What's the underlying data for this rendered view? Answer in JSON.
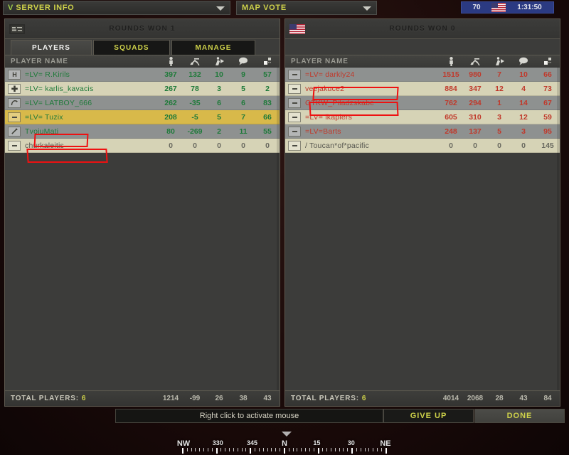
{
  "topbar": {
    "server_info_label": "SERVER INFO",
    "map_vote_label": "MAP VOTE"
  },
  "hud": {
    "tickets": "70",
    "time": "1:31:50",
    "flag_icon": "us-flag-icon"
  },
  "teams": [
    {
      "side": "left",
      "flag_icon": "mec-flag-icon",
      "rounds_won_label": "ROUNDS WON 1",
      "tabs": [
        {
          "label": "PLAYERS",
          "active": true
        },
        {
          "label": "SQUADS",
          "active": false
        },
        {
          "label": "MANAGE",
          "active": false
        }
      ],
      "columns": {
        "name_header": "PLAYER NAME",
        "icons": [
          "player-icon",
          "kills-icon",
          "deaths-icon",
          "chat-icon",
          "squad-icon"
        ]
      },
      "players": [
        {
          "class_icon": "support-icon",
          "name": "=LV= R.Kirils",
          "stats": [
            "397",
            "132",
            "10",
            "9",
            "57"
          ],
          "row": "dark",
          "zero": false
        },
        {
          "class_icon": "medic-icon",
          "name": "=LV= karlis_kavacis",
          "stats": [
            "267",
            "78",
            "3",
            "5",
            "2"
          ],
          "row": "light",
          "zero": false
        },
        {
          "class_icon": "engineer-icon",
          "name": "=LV= LATBOY_666",
          "stats": [
            "262",
            "-35",
            "6",
            "6",
            "83"
          ],
          "row": "dark",
          "zero": false
        },
        {
          "class_icon": "none-icon",
          "name": "=LV= Tuzix",
          "stats": [
            "208",
            "-5",
            "5",
            "7",
            "66"
          ],
          "row": "hl",
          "zero": false
        },
        {
          "class_icon": "sniper-icon",
          "name": "TvojuMatj",
          "stats": [
            "80",
            "-269",
            "2",
            "11",
            "55"
          ],
          "row": "dark",
          "zero": false
        },
        {
          "class_icon": "none-icon",
          "name": "churkaleitis",
          "stats": [
            "0",
            "0",
            "0",
            "0",
            "0"
          ],
          "row": "light",
          "zero": true
        }
      ],
      "totals": {
        "label": "TOTAL PLAYERS:",
        "count": "6",
        "stats": [
          "1214",
          "-99",
          "26",
          "38",
          "43"
        ]
      }
    },
    {
      "side": "right",
      "flag_icon": "us-flag-icon",
      "rounds_won_label": "ROUNDS WON 0",
      "columns": {
        "name_header": "PLAYER NAME",
        "icons": [
          "player-icon",
          "kills-icon",
          "deaths-icon",
          "chat-icon",
          "squad-icon"
        ]
      },
      "players": [
        {
          "class_icon": "none-icon",
          "name": "=LV= darkly24",
          "stats": [
            "1515",
            "980",
            "7",
            "10",
            "66"
          ],
          "row": "dark",
          "zero": false
        },
        {
          "class_icon": "none-icon",
          "name": "veejakuce2",
          "stats": [
            "884",
            "347",
            "12",
            "4",
            "73"
          ],
          "row": "light",
          "zero": false
        },
        {
          "class_icon": "none-icon",
          "name": "GTKW_Piladzskabe",
          "stats": [
            "762",
            "294",
            "1",
            "14",
            "67"
          ],
          "row": "dark",
          "zero": false
        },
        {
          "class_icon": "none-icon",
          "name": "=LV= ikaplers",
          "stats": [
            "605",
            "310",
            "3",
            "12",
            "59"
          ],
          "row": "light",
          "zero": false
        },
        {
          "class_icon": "none-icon",
          "name": "=LV=Barts",
          "stats": [
            "248",
            "137",
            "5",
            "3",
            "95"
          ],
          "row": "dark",
          "zero": false
        },
        {
          "class_icon": "none-icon",
          "name": "/ Toucan*of*pacific",
          "stats": [
            "0",
            "0",
            "0",
            "0",
            "145"
          ],
          "row": "light",
          "zero": true
        }
      ],
      "totals": {
        "label": "TOTAL PLAYERS:",
        "count": "6",
        "stats": [
          "4014",
          "2068",
          "28",
          "43",
          "84"
        ]
      }
    }
  ],
  "bottom": {
    "hint": "Right click to activate mouse",
    "give_up_label": "GIVE UP",
    "done_label": "DONE"
  },
  "compass": {
    "labels": [
      {
        "text": "NW",
        "pos": 0,
        "major": true
      },
      {
        "text": "330",
        "pos": 0.17,
        "major": false
      },
      {
        "text": "345",
        "pos": 0.34,
        "major": false
      },
      {
        "text": "N",
        "pos": 0.5,
        "major": true
      },
      {
        "text": "15",
        "pos": 0.66,
        "major": false
      },
      {
        "text": "30",
        "pos": 0.83,
        "major": false
      },
      {
        "text": "NE",
        "pos": 1.0,
        "major": true
      }
    ]
  }
}
